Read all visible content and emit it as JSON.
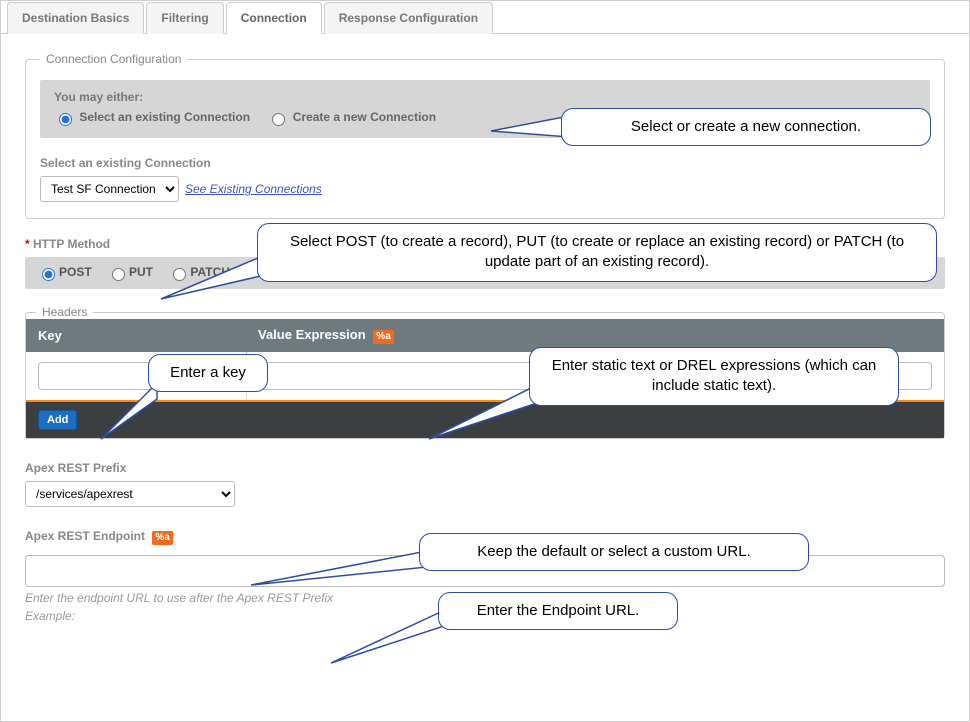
{
  "tabs": {
    "items": [
      {
        "label": "Destination Basics"
      },
      {
        "label": "Filtering"
      },
      {
        "label": "Connection"
      },
      {
        "label": "Response Configuration"
      }
    ],
    "activeIndex": 2
  },
  "connectionConfig": {
    "legend": "Connection Configuration",
    "prompt": "You may either:",
    "optExisting": "Select an existing Connection",
    "optNew": "Create a new Connection",
    "selected": "existing"
  },
  "existingConn": {
    "label": "Select an existing Connection",
    "value": "Test SF Connection",
    "link": "See Existing Connections"
  },
  "httpMethod": {
    "label": "HTTP Method",
    "options": [
      "POST",
      "PUT",
      "PATCH"
    ],
    "selected": "POST"
  },
  "headers": {
    "legend": "Headers",
    "colKey": "Key",
    "colValue": "Value Expression",
    "badge": "%a",
    "row": {
      "key": "",
      "value": ""
    },
    "addLabel": "Add"
  },
  "apexPrefix": {
    "label": "Apex REST Prefix",
    "value": "/services/apexrest"
  },
  "apexEndpoint": {
    "label": "Apex REST Endpoint",
    "badge": "%a",
    "value": "",
    "helper1": "Enter the endpoint URL to use after the Apex REST Prefix",
    "helper2": "Example:"
  },
  "callouts": {
    "c1": "Select or create a new connection.",
    "c2": "Select POST (to create a record), PUT (to create or replace an existing record) or PATCH (to update part of an existing record).",
    "c3": "Enter a key",
    "c4": "Enter static text or DREL expressions (which can include static text).",
    "c5": "Keep the default or select a custom URL.",
    "c6": "Enter the Endpoint URL."
  }
}
